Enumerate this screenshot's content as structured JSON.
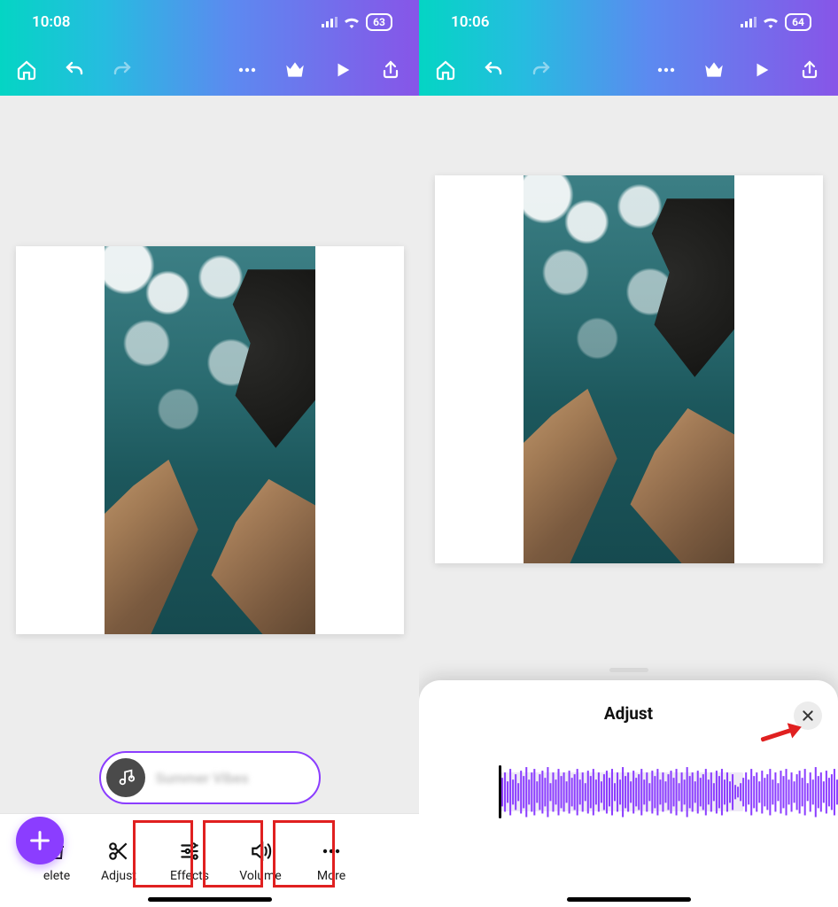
{
  "left": {
    "status_time": "10:08",
    "battery": "63",
    "audio_chip_label": "Summer Vibes",
    "fab_glyph": "+",
    "context_items": [
      {
        "id": "delete",
        "label": "elete"
      },
      {
        "id": "adjust",
        "label": "Adjust"
      },
      {
        "id": "effects",
        "label": "Effects"
      },
      {
        "id": "volume",
        "label": "Volume"
      },
      {
        "id": "more",
        "label": "More"
      }
    ]
  },
  "right": {
    "status_time": "10:06",
    "battery": "64",
    "sheet_title": "Adjust"
  },
  "icons": {
    "signal": "signal-icon",
    "wifi": "wifi-icon",
    "home": "home-icon",
    "undo": "undo-icon",
    "redo": "redo-icon",
    "more": "more-icon",
    "crown": "crown-icon",
    "play": "play-icon",
    "share": "share-icon",
    "trash": "trash-icon",
    "scissors": "scissors-icon",
    "sliders": "sliders-icon",
    "speaker": "speaker-icon",
    "dots": "dots-icon",
    "note": "note-icon",
    "close": "close-icon",
    "plus": "plus-icon"
  }
}
